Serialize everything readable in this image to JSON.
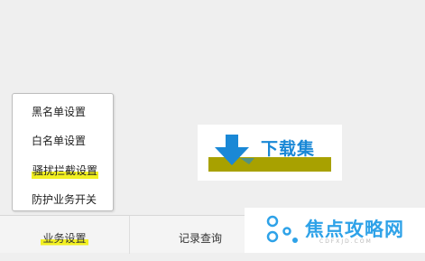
{
  "popup_menu": {
    "items": [
      {
        "label": "黑名单设置",
        "highlighted": false
      },
      {
        "label": "白名单设置",
        "highlighted": false
      },
      {
        "label": "骚扰拦截设置",
        "highlighted": true
      },
      {
        "label": "防护业务开关",
        "highlighted": false
      }
    ]
  },
  "bottom_tabs": [
    {
      "label": "业务设置",
      "active": true
    },
    {
      "label": "记录查询",
      "active": false
    }
  ],
  "watermarks": {
    "download_logo_text": "下载集",
    "brand_text": "焦点攻略网",
    "brand_domain": "CDFXJD.COM"
  },
  "colors": {
    "highlight": "#f2f021",
    "logo_blue": "#1a88d6",
    "brand_blue": "#2ea2e8",
    "logo_strip": "#a8a100"
  }
}
